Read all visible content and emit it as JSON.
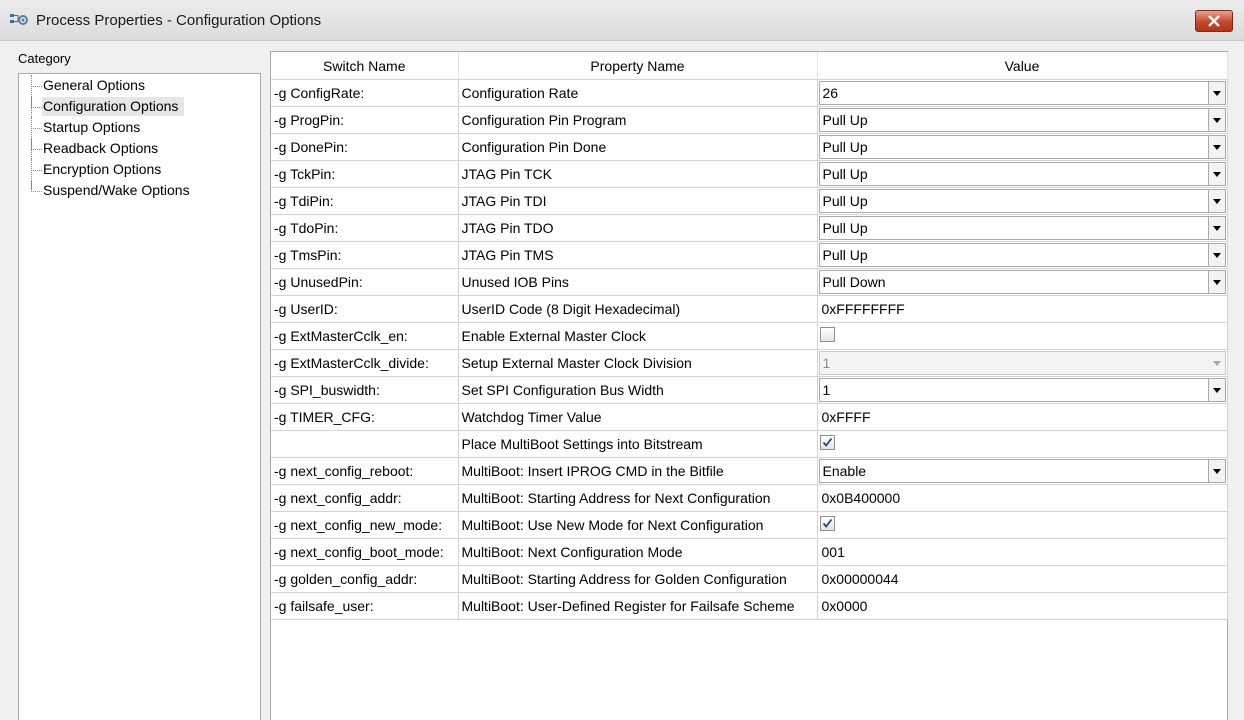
{
  "window": {
    "title": "Process Properties - Configuration Options"
  },
  "sidebar": {
    "label": "Category",
    "items": [
      {
        "label": "General Options"
      },
      {
        "label": "Configuration Options",
        "selected": true
      },
      {
        "label": "Startup Options"
      },
      {
        "label": "Readback Options"
      },
      {
        "label": "Encryption Options"
      },
      {
        "label": "Suspend/Wake Options"
      }
    ]
  },
  "grid": {
    "headers": [
      "Switch Name",
      "Property Name",
      "Value"
    ],
    "rows": [
      {
        "switch": "-g ConfigRate:",
        "property": "Configuration Rate",
        "type": "combo",
        "value": "26"
      },
      {
        "switch": "-g ProgPin:",
        "property": "Configuration Pin Program",
        "type": "combo",
        "value": "Pull Up"
      },
      {
        "switch": "-g DonePin:",
        "property": "Configuration Pin Done",
        "type": "combo",
        "value": "Pull Up"
      },
      {
        "switch": "-g TckPin:",
        "property": "JTAG Pin TCK",
        "type": "combo",
        "value": "Pull Up"
      },
      {
        "switch": "-g TdiPin:",
        "property": "JTAG Pin TDI",
        "type": "combo",
        "value": "Pull Up"
      },
      {
        "switch": "-g TdoPin:",
        "property": "JTAG Pin TDO",
        "type": "combo",
        "value": "Pull Up"
      },
      {
        "switch": "-g TmsPin:",
        "property": "JTAG Pin TMS",
        "type": "combo",
        "value": "Pull Up"
      },
      {
        "switch": "-g UnusedPin:",
        "property": "Unused IOB Pins",
        "type": "combo",
        "value": "Pull Down"
      },
      {
        "switch": "-g UserID:",
        "property": "UserID Code (8 Digit Hexadecimal)",
        "type": "text",
        "value": "0xFFFFFFFF"
      },
      {
        "switch": "-g ExtMasterCclk_en:",
        "property": "Enable External Master Clock",
        "type": "check",
        "checked": false
      },
      {
        "switch": "-g ExtMasterCclk_divide:",
        "property": "Setup External Master Clock Division",
        "type": "combo-disabled",
        "value": "1"
      },
      {
        "switch": "-g SPI_buswidth:",
        "property": "Set SPI Configuration Bus Width",
        "type": "combo",
        "value": "1"
      },
      {
        "switch": "-g TIMER_CFG:",
        "property": "Watchdog Timer Value",
        "type": "text",
        "value": "0xFFFF"
      },
      {
        "switch": "",
        "property": "Place MultiBoot Settings into Bitstream",
        "type": "check",
        "checked": true
      },
      {
        "switch": "-g next_config_reboot:",
        "property": "MultiBoot: Insert IPROG CMD in the Bitfile",
        "type": "combo",
        "value": "Enable"
      },
      {
        "switch": "-g next_config_addr:",
        "property": "MultiBoot: Starting Address for Next Configuration",
        "type": "text",
        "value": "0x0B400000"
      },
      {
        "switch": "-g next_config_new_mode:",
        "property": "MultiBoot: Use New Mode for Next Configuration",
        "type": "check",
        "checked": true
      },
      {
        "switch": "-g next_config_boot_mode:",
        "property": "MultiBoot: Next Configuration Mode",
        "type": "text",
        "value": "001"
      },
      {
        "switch": "-g golden_config_addr:",
        "property": "MultiBoot: Starting Address for Golden Configuration",
        "type": "text",
        "value": "0x00000044"
      },
      {
        "switch": "-g failsafe_user:",
        "property": "MultiBoot: User-Defined Register for Failsafe Scheme",
        "type": "text",
        "value": "0x0000"
      }
    ]
  }
}
